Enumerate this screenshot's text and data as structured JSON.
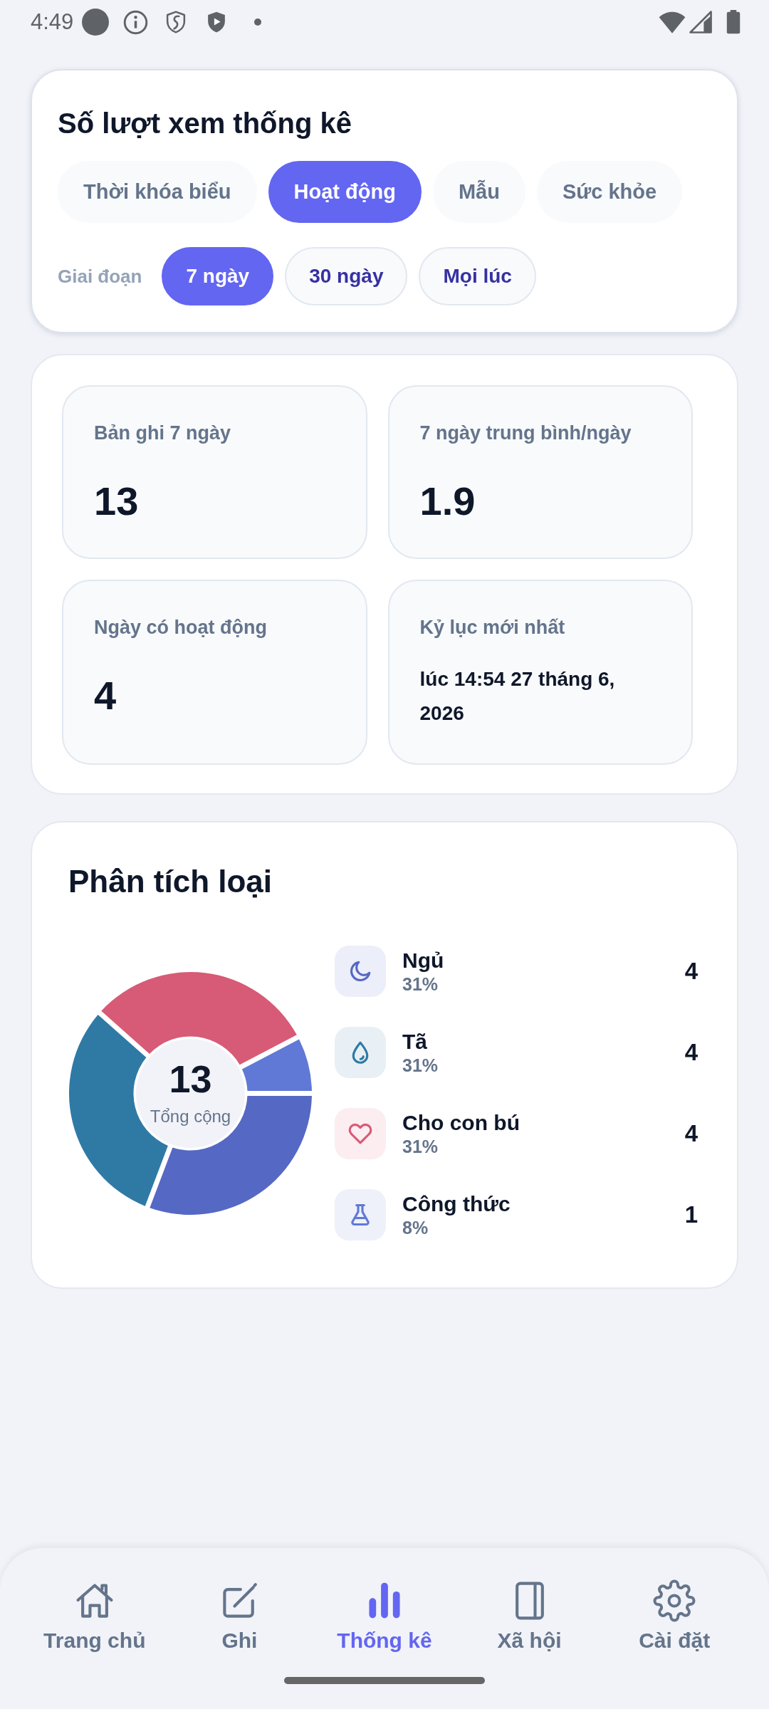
{
  "status_bar": {
    "time": "4:49"
  },
  "filter_card": {
    "title": "Số lượt xem thống kê",
    "tabs": [
      {
        "label": "Thời khóa biểu",
        "selected": false
      },
      {
        "label": "Hoạt động",
        "selected": true
      },
      {
        "label": "Mẫu",
        "selected": false
      },
      {
        "label": "Sức khỏe",
        "selected": false
      }
    ],
    "period_label": "Giai đoạn",
    "periods": [
      {
        "label": "7 ngày",
        "selected": true
      },
      {
        "label": "30 ngày",
        "selected": false
      },
      {
        "label": "Mọi lúc",
        "selected": false
      }
    ]
  },
  "stats": [
    {
      "kind": "number",
      "label": "Bản ghi 7 ngày",
      "value": "13"
    },
    {
      "kind": "number",
      "label": "7 ngày trung bình/ngày",
      "value": "1.9"
    },
    {
      "kind": "number",
      "label": "Ngày có hoạt động",
      "value": "4"
    },
    {
      "kind": "text",
      "label": "Kỷ lục mới nhất",
      "value": "lúc 14:54 27 tháng 6, 2026"
    }
  ],
  "breakdown": {
    "title": "Phân tích loại",
    "total": "13",
    "total_label": "Tổng cộng",
    "chart_data": {
      "type": "donut",
      "legend": "right",
      "categories": [
        "Ngủ",
        "Tã",
        "Cho con bú",
        "Công thức"
      ],
      "values": [
        4,
        4,
        4,
        1
      ],
      "value_labels": [
        "4",
        "4",
        "4",
        "1"
      ]
    },
    "items": [
      {
        "kind": "sleep",
        "color": "#5568c4",
        "percent": "31%"
      },
      {
        "kind": "diaper",
        "color": "#2f7aa5",
        "percent": "31%"
      },
      {
        "kind": "feeding",
        "color": "#d75b76",
        "percent": "31%"
      },
      {
        "kind": "formula",
        "color": "#6079d6",
        "percent": "8%"
      }
    ]
  },
  "bottom_nav": [
    {
      "kind": "home",
      "label": "Trang chủ",
      "selected": false
    },
    {
      "kind": "record",
      "label": "Ghi",
      "selected": false
    },
    {
      "kind": "stats",
      "label": "Thống kê",
      "selected": true
    },
    {
      "kind": "social",
      "label": "Xã hội",
      "selected": false
    },
    {
      "kind": "settings",
      "label": "Cài đặt",
      "selected": false
    }
  ]
}
